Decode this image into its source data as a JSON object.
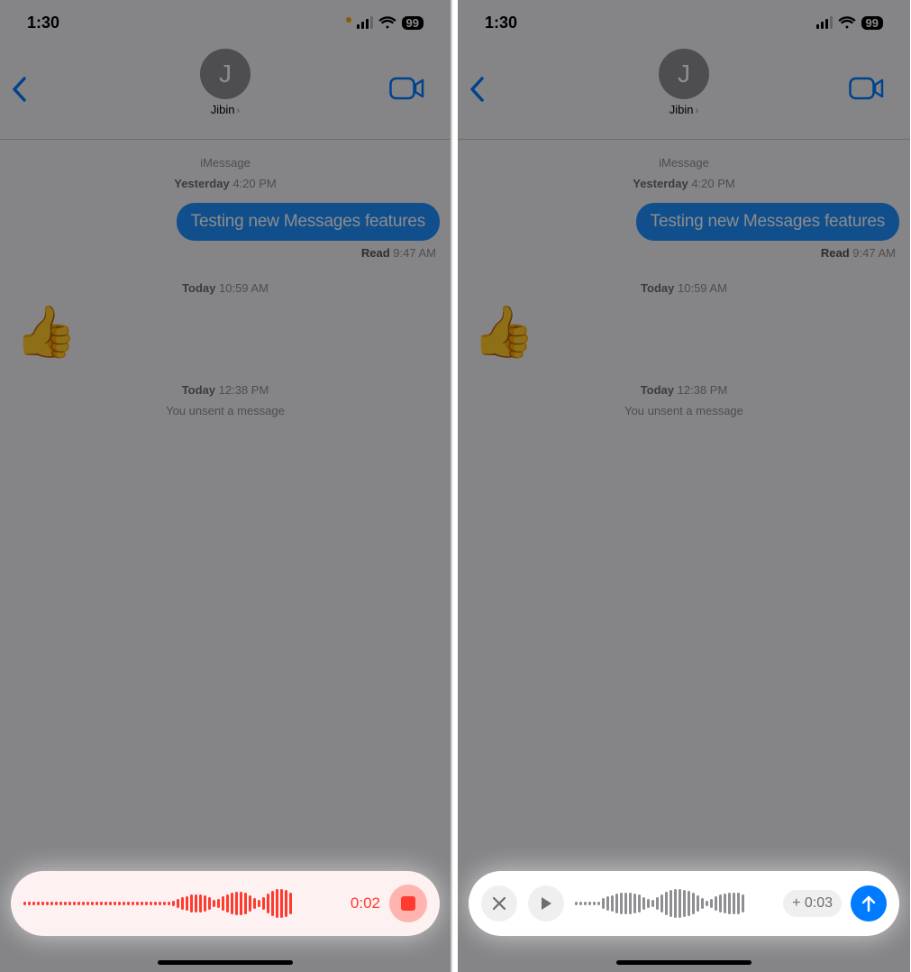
{
  "status": {
    "time": "1:30",
    "battery": "99"
  },
  "contact": {
    "name": "Jibin",
    "initial": "J"
  },
  "thread": {
    "service": "iMessage",
    "ts1_day": "Yesterday",
    "ts1_time": "4:20 PM",
    "msg1": "Testing new Messages features",
    "read_label": "Read",
    "read_time": "9:47 AM",
    "ts2_day": "Today",
    "ts2_time": "10:59 AM",
    "emoji": "👍",
    "ts3_day": "Today",
    "ts3_time": "12:38 PM",
    "unsent": "You unsent a message"
  },
  "rec": {
    "timer": "0:02"
  },
  "play": {
    "plus_label": "+ 0:03"
  },
  "colors": {
    "accent": "#007aff",
    "record": "#ff3b30"
  }
}
